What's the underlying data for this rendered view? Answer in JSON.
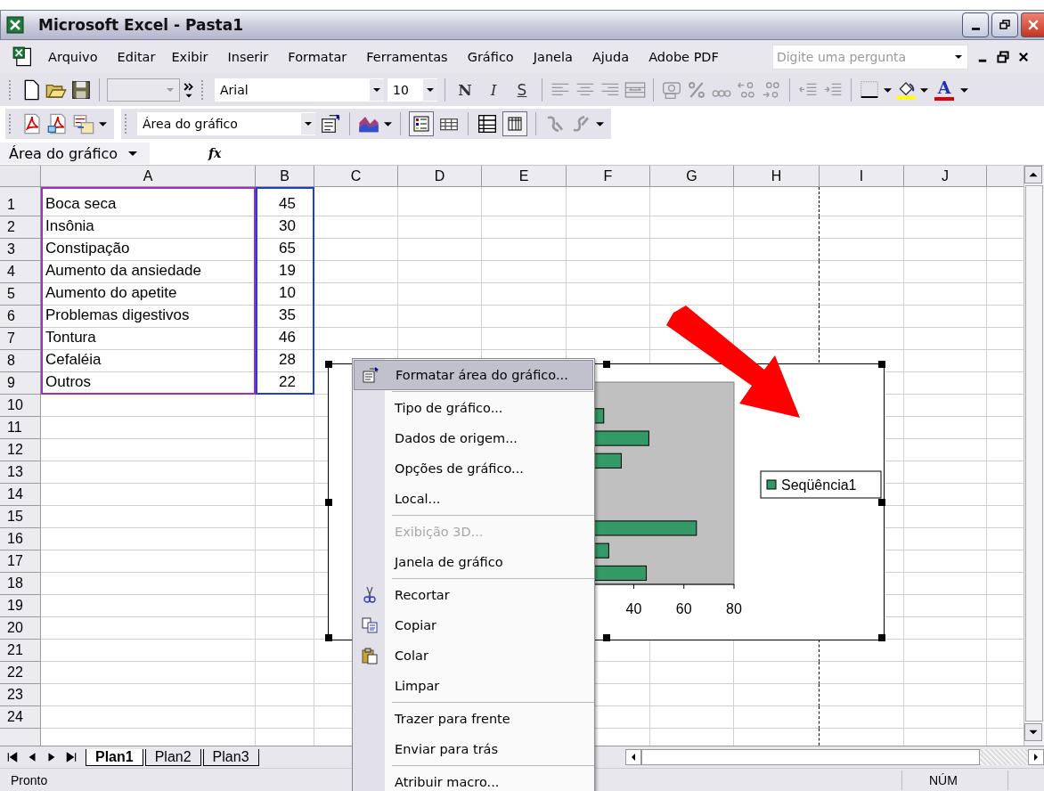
{
  "window": {
    "title": "Microsoft Excel - Pasta1"
  },
  "menu_bar": {
    "items": [
      "Arquivo",
      "Editar",
      "Exibir",
      "Inserir",
      "Formatar",
      "Ferramentas",
      "Gráfico",
      "Janela",
      "Ajuda",
      "Adobe PDF"
    ],
    "help_search": {
      "placeholder": "Digite uma pergunta"
    }
  },
  "formatting_toolbar": {
    "font": "Arial",
    "size": "10",
    "bold": "N",
    "italic": "I",
    "underline": "S",
    "font_color": "A"
  },
  "chart_toolbar": {
    "chart_object": "Área do gráfico"
  },
  "formula_bar": {
    "name_box": "Área do gráfico",
    "fx": "fx"
  },
  "sheet": {
    "columns": [
      "A",
      "B",
      "C",
      "D",
      "E",
      "F",
      "G",
      "H",
      "I",
      "J"
    ],
    "rows": [
      {
        "number": "1",
        "a": "Boca seca",
        "b": "45"
      },
      {
        "number": "2",
        "a": "Insônia",
        "b": "30"
      },
      {
        "number": "3",
        "a": "Constipação",
        "b": "65"
      },
      {
        "number": "4",
        "a": "Aumento da ansiedade",
        "b": "19"
      },
      {
        "number": "5",
        "a": "Aumento do apetite",
        "b": "10"
      },
      {
        "number": "6",
        "a": "Problemas digestivos",
        "b": "35"
      },
      {
        "number": "7",
        "a": "Tontura",
        "b": "46"
      },
      {
        "number": "8",
        "a": "Cefaléia",
        "b": "28"
      },
      {
        "number": "9",
        "a": "Outros",
        "b": "22"
      },
      {
        "number": "10"
      },
      {
        "number": "11"
      },
      {
        "number": "12"
      },
      {
        "number": "13"
      },
      {
        "number": "14"
      },
      {
        "number": "15"
      },
      {
        "number": "16"
      },
      {
        "number": "17"
      },
      {
        "number": "18"
      },
      {
        "number": "19"
      },
      {
        "number": "20"
      },
      {
        "number": "21"
      },
      {
        "number": "22"
      },
      {
        "number": "23"
      },
      {
        "number": "24"
      }
    ]
  },
  "chart": {
    "axis_ticks": [
      "40",
      "60",
      "80"
    ],
    "legend": "Seqüência1"
  },
  "context_menu": {
    "items": [
      {
        "kind": "item",
        "label": "Formatar área do gráfico...",
        "selected": true,
        "disabled": false
      },
      {
        "kind": "separator"
      },
      {
        "kind": "item",
        "label": "Tipo de gráfico...",
        "selected": false,
        "disabled": false
      },
      {
        "kind": "item",
        "label": "Dados de origem...",
        "selected": false,
        "disabled": false
      },
      {
        "kind": "item",
        "label": "Opções de gráfico...",
        "selected": false,
        "disabled": false
      },
      {
        "kind": "item",
        "label": "Local...",
        "selected": false,
        "disabled": false
      },
      {
        "kind": "separator"
      },
      {
        "kind": "item",
        "label": "Exibição 3D...",
        "selected": false,
        "disabled": true
      },
      {
        "kind": "item",
        "label": "Janela de gráfico",
        "selected": false,
        "disabled": false
      },
      {
        "kind": "separator"
      },
      {
        "kind": "item",
        "label": "Recortar",
        "selected": false,
        "disabled": false
      },
      {
        "kind": "item",
        "label": "Copiar",
        "selected": false,
        "disabled": false
      },
      {
        "kind": "item",
        "label": "Colar",
        "selected": false,
        "disabled": false
      },
      {
        "kind": "item",
        "label": "Limpar",
        "selected": false,
        "disabled": false
      },
      {
        "kind": "separator"
      },
      {
        "kind": "item",
        "label": "Trazer para frente",
        "selected": false,
        "disabled": false
      },
      {
        "kind": "item",
        "label": "Enviar para trás",
        "selected": false,
        "disabled": false
      },
      {
        "kind": "separator"
      },
      {
        "kind": "item",
        "label": "Atribuir macro...",
        "selected": false,
        "disabled": false
      }
    ]
  },
  "sheet_tabs": [
    {
      "label": "Plan1",
      "selected": true
    },
    {
      "label": "Plan2",
      "selected": false
    },
    {
      "label": "Plan3",
      "selected": false
    }
  ],
  "status_bar": {
    "status": "Pronto",
    "num_lock": "NÚM"
  }
}
